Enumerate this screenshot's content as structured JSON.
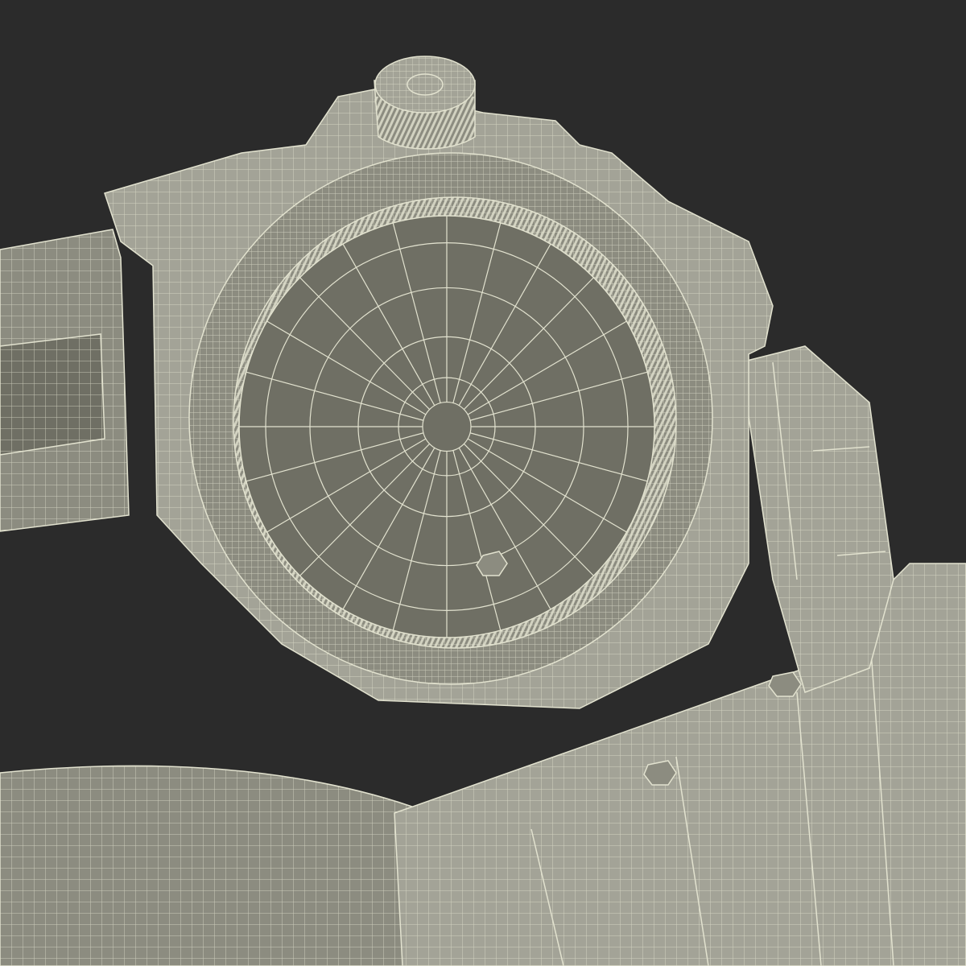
{
  "scene": {
    "subject": "wireframe-watch-render",
    "colors": {
      "background": "#2b2b2b",
      "surface": "#8c8c80",
      "surface_light": "#a3a397",
      "surface_dark": "#6f6f64",
      "wire": "#e2e2cf"
    }
  }
}
